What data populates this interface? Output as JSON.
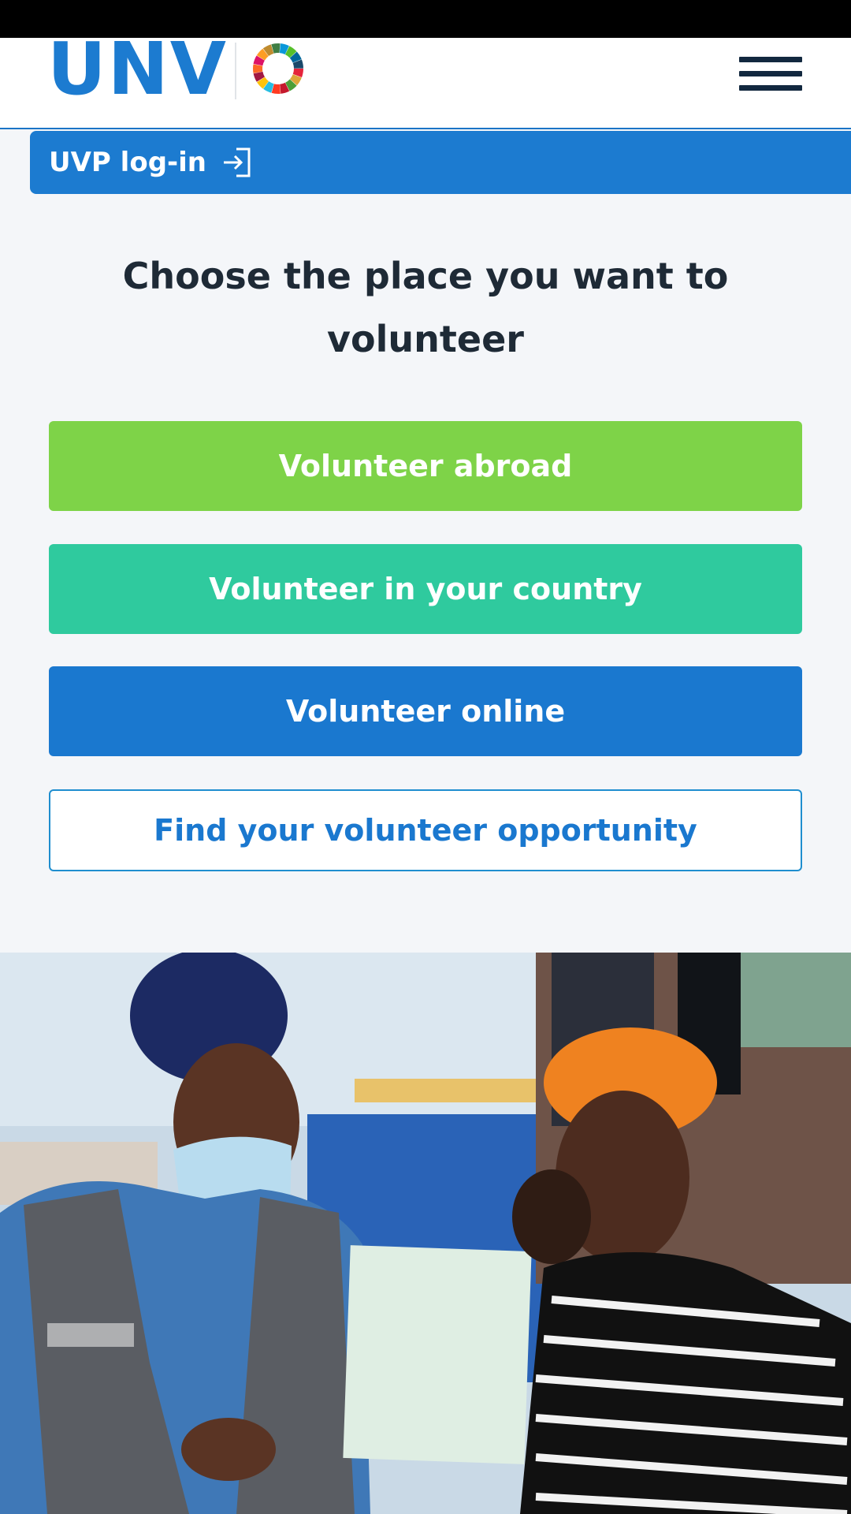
{
  "header": {
    "logo_text": "UNV",
    "menu_icon": "hamburger-menu-icon",
    "sdg_icon": "sdg-color-wheel-icon"
  },
  "login": {
    "label": "UVP log-in",
    "icon": "sign-in-icon"
  },
  "main": {
    "heading": "Choose the place you want to volunteer",
    "buttons": [
      {
        "label": "Volunteer abroad"
      },
      {
        "label": "Volunteer in your country"
      },
      {
        "label": "Volunteer online"
      },
      {
        "label": "Find your volunteer opportunity"
      }
    ]
  },
  "colors": {
    "brand_blue": "#1c7bd0",
    "abroad_green": "#7ed348",
    "country_teal": "#2fca9e",
    "online_blue": "#1a78cf",
    "outline_blue": "#1f8ecf"
  }
}
